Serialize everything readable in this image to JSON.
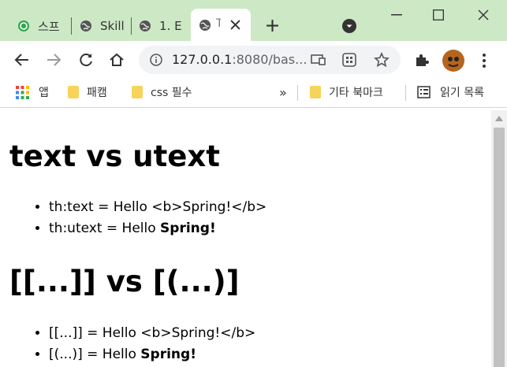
{
  "tabs": [
    {
      "label": "스프",
      "icon": "green-app-icon",
      "active": false
    },
    {
      "label": "Skill",
      "icon": "globe-icon",
      "active": false
    },
    {
      "label": "1. E",
      "icon": "globe-icon",
      "active": false
    },
    {
      "label": "T",
      "icon": "globe-icon",
      "active": true
    }
  ],
  "toolbar": {
    "url_host": "127.0.0.1",
    "url_rest": ":8080/bas..."
  },
  "bookmarks": {
    "items": [
      "앱",
      "패캠",
      "css 필수"
    ],
    "overflow": "»",
    "other": "기타 북마크",
    "reading_list": "읽기 목록"
  },
  "page": {
    "h1": "text vs utext",
    "list1": [
      "th:text = Hello <b>Spring!</b>",
      "th:utext = Hello ",
      "Spring!"
    ],
    "h2": "[[...]] vs [(...)]",
    "list2": [
      "[[...]] = Hello <b>Spring!</b>",
      "[(...)] = Hello ",
      "Spring!"
    ]
  },
  "colors": {
    "tabstrip": "#cde8c4",
    "omnibox": "#f1f3f4"
  }
}
